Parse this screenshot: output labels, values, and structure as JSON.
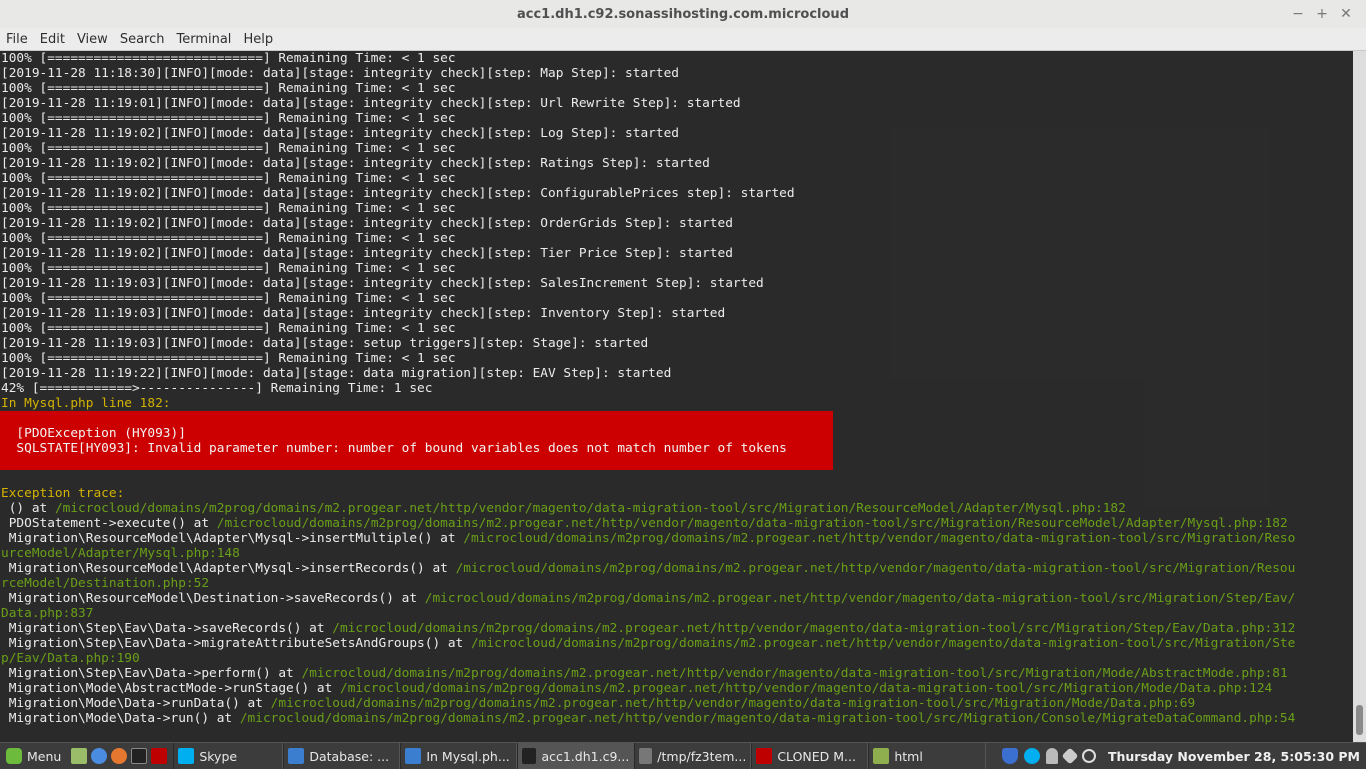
{
  "window": {
    "title": "acc1.dh1.c92.sonassihosting.com.microcloud",
    "minimize": "−",
    "maximize": "+",
    "close": "✕"
  },
  "menu": [
    "File",
    "Edit",
    "View",
    "Search",
    "Terminal",
    "Help"
  ],
  "terminal": {
    "lines": [
      "100% [============================] Remaining Time: < 1 sec",
      "[2019-11-28 11:18:30][INFO][mode: data][stage: integrity check][step: Map Step]: started",
      "100% [============================] Remaining Time: < 1 sec",
      "[2019-11-28 11:19:01][INFO][mode: data][stage: integrity check][step: Url Rewrite Step]: started",
      "100% [============================] Remaining Time: < 1 sec",
      "[2019-11-28 11:19:02][INFO][mode: data][stage: integrity check][step: Log Step]: started",
      "100% [============================] Remaining Time: < 1 sec",
      "[2019-11-28 11:19:02][INFO][mode: data][stage: integrity check][step: Ratings Step]: started",
      "100% [============================] Remaining Time: < 1 sec",
      "[2019-11-28 11:19:02][INFO][mode: data][stage: integrity check][step: ConfigurablePrices step]: started",
      "100% [============================] Remaining Time: < 1 sec",
      "[2019-11-28 11:19:02][INFO][mode: data][stage: integrity check][step: OrderGrids Step]: started",
      "100% [============================] Remaining Time: < 1 sec",
      "[2019-11-28 11:19:02][INFO][mode: data][stage: integrity check][step: Tier Price Step]: started",
      "100% [============================] Remaining Time: < 1 sec",
      "[2019-11-28 11:19:03][INFO][mode: data][stage: integrity check][step: SalesIncrement Step]: started",
      "100% [============================] Remaining Time: < 1 sec",
      "[2019-11-28 11:19:03][INFO][mode: data][stage: integrity check][step: Inventory Step]: started",
      "100% [============================] Remaining Time: < 1 sec",
      "[2019-11-28 11:19:03][INFO][mode: data][stage: setup triggers][step: Stage]: started",
      "100% [============================] Remaining Time: < 1 sec",
      "[2019-11-28 11:19:22][INFO][mode: data][stage: data migration][step: EAV Step]: started",
      "42% [============>---------------] Remaining Time: 1 sec"
    ],
    "error_header": "In Mysql.php line 182:",
    "error_box": [
      "  [PDOException (HY093)]",
      "  SQLSTATE[HY093]: Invalid parameter number: number of bound variables does not match number of tokens"
    ],
    "trace_header": "Exception trace:",
    "trace": [
      {
        "call": " () at ",
        "path": "/microcloud/domains/m2prog/domains/m2.progear.net/http/vendor/magento/data-migration-tool/src/Migration/ResourceModel/Adapter/Mysql.php:182"
      },
      {
        "call": " PDOStatement->execute() at ",
        "path": "/microcloud/domains/m2prog/domains/m2.progear.net/http/vendor/magento/data-migration-tool/src/Migration/ResourceModel/Adapter/Mysql.php:182"
      },
      {
        "call": " Migration\\ResourceModel\\Adapter\\Mysql->insertMultiple() at ",
        "path": "/microcloud/domains/m2prog/domains/m2.progear.net/http/vendor/magento/data-migration-tool/src/Migration/Reso"
      },
      {
        "call": "",
        "path": "urceModel/Adapter/Mysql.php:148"
      },
      {
        "call": " Migration\\ResourceModel\\Adapter\\Mysql->insertRecords() at ",
        "path": "/microcloud/domains/m2prog/domains/m2.progear.net/http/vendor/magento/data-migration-tool/src/Migration/Resou"
      },
      {
        "call": "",
        "path": "rceModel/Destination.php:52"
      },
      {
        "call": " Migration\\ResourceModel\\Destination->saveRecords() at ",
        "path": "/microcloud/domains/m2prog/domains/m2.progear.net/http/vendor/magento/data-migration-tool/src/Migration/Step/Eav/"
      },
      {
        "call": "",
        "path": "Data.php:837"
      },
      {
        "call": " Migration\\Step\\Eav\\Data->saveRecords() at ",
        "path": "/microcloud/domains/m2prog/domains/m2.progear.net/http/vendor/magento/data-migration-tool/src/Migration/Step/Eav/Data.php:312"
      },
      {
        "call": " Migration\\Step\\Eav\\Data->migrateAttributeSetsAndGroups() at ",
        "path": "/microcloud/domains/m2prog/domains/m2.progear.net/http/vendor/magento/data-migration-tool/src/Migration/Ste"
      },
      {
        "call": "",
        "path": "p/Eav/Data.php:190"
      },
      {
        "call": " Migration\\Step\\Eav\\Data->perform() at ",
        "path": "/microcloud/domains/m2prog/domains/m2.progear.net/http/vendor/magento/data-migration-tool/src/Migration/Mode/AbstractMode.php:81"
      },
      {
        "call": " Migration\\Mode\\AbstractMode->runStage() at ",
        "path": "/microcloud/domains/m2prog/domains/m2.progear.net/http/vendor/magento/data-migration-tool/src/Migration/Mode/Data.php:124"
      },
      {
        "call": " Migration\\Mode\\Data->runData() at ",
        "path": "/microcloud/domains/m2prog/domains/m2.progear.net/http/vendor/magento/data-migration-tool/src/Migration/Mode/Data.php:69"
      },
      {
        "call": " Migration\\Mode\\Data->run() at ",
        "path": "/microcloud/domains/m2prog/domains/m2.progear.net/http/vendor/magento/data-migration-tool/src/Migration/Console/MigrateDataCommand.php:54"
      }
    ]
  },
  "taskbar": {
    "menu_label": "Menu",
    "items": [
      {
        "label": "Skype",
        "icon": "skype-icon",
        "color": "#00aff0"
      },
      {
        "label": "Database: ...",
        "icon": "browser-icon",
        "color": "#3b7ed0"
      },
      {
        "label": "In Mysql.ph...",
        "icon": "browser-icon",
        "color": "#3b7ed0"
      },
      {
        "label": "acc1.dh1.c9...",
        "icon": "terminal-icon",
        "color": "#222222"
      },
      {
        "label": "/tmp/fz3tem...",
        "icon": "editor-icon",
        "color": "#777777"
      },
      {
        "label": "CLONED M...",
        "icon": "filezilla-icon",
        "color": "#bf0000"
      },
      {
        "label": "html",
        "icon": "folder-icon",
        "color": "#8fae4e"
      }
    ],
    "clock": "Thursday November 28,  5:05:30 PM"
  },
  "colors": {
    "terminal_bg": "#2b2b2b",
    "error_bg": "#cc0000",
    "warning_text": "#d4b300",
    "path_text": "#6a9f18"
  }
}
